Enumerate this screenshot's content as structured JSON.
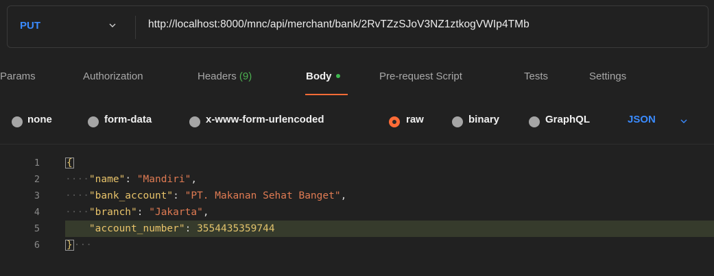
{
  "request": {
    "method": "PUT",
    "url": "http://localhost:8000/mnc/api/merchant/bank/2RvTZzSJoV3NZ1ztkogVWIp4TMb"
  },
  "tabs": [
    {
      "label": "Params"
    },
    {
      "label": "Authorization"
    },
    {
      "label": "Headers",
      "count": "(9)"
    },
    {
      "label": "Body"
    },
    {
      "label": "Pre-request Script"
    },
    {
      "label": "Tests"
    },
    {
      "label": "Settings"
    }
  ],
  "body_types": {
    "options": [
      "none",
      "form-data",
      "x-www-form-urlencoded",
      "raw",
      "binary",
      "GraphQL"
    ],
    "selected": "raw",
    "language": "JSON"
  },
  "editor": {
    "line_numbers": [
      "1",
      "2",
      "3",
      "4",
      "5",
      "6"
    ],
    "lines": [
      {
        "open": "{"
      },
      {
        "key": "\"name\"",
        "sep": ": ",
        "value": "\"Mandiri\"",
        "end": ","
      },
      {
        "key": "\"bank_account\"",
        "sep": ": ",
        "value": "\"PT. Makanan Sehat Banget\"",
        "end": ","
      },
      {
        "key": "\"branch\"",
        "sep": ": ",
        "value": "\"Jakarta\"",
        "end": ","
      },
      {
        "key": "\"account_number\"",
        "sep": ": ",
        "value": "3554435359744",
        "end": ""
      },
      {
        "close": "}"
      }
    ]
  },
  "colors": {
    "accent_orange": "#ff6c37",
    "method_blue": "#3a8bff",
    "status_green": "#3fb950"
  }
}
